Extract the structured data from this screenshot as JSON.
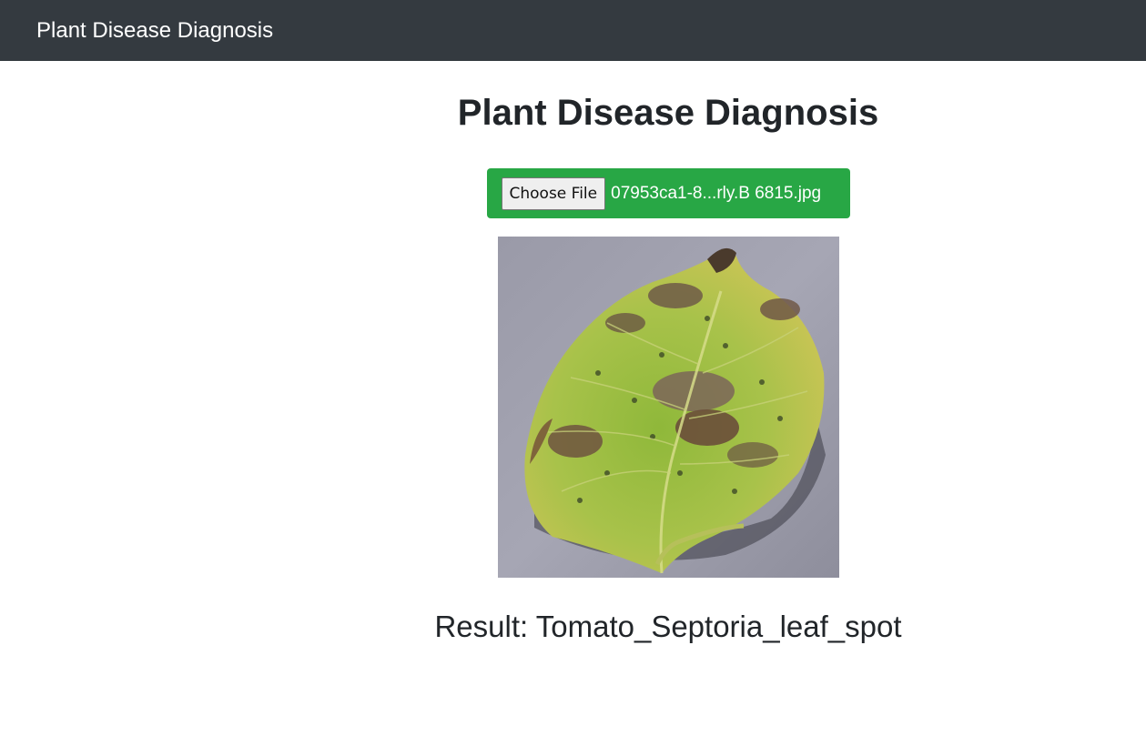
{
  "navbar": {
    "brand": "Plant Disease Diagnosis"
  },
  "main": {
    "title": "Plant Disease Diagnosis",
    "upload": {
      "button_label": "Choose File",
      "file_name": "07953ca1-8...rly.B 6815.jpg"
    },
    "result_text": "Result: Tomato_Septoria_leaf_spot"
  },
  "colors": {
    "navbar_bg": "#343a40",
    "upload_bg": "#28a745",
    "text": "#212529"
  },
  "icons": {
    "uploaded_image": "diseased-leaf-photo"
  }
}
